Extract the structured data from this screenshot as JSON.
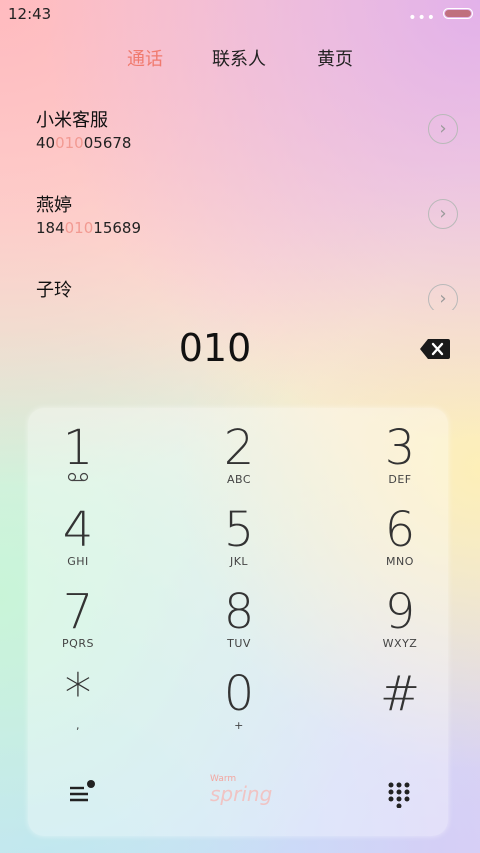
{
  "status": {
    "time": "12:43",
    "more": "•••"
  },
  "tabs": [
    "通话",
    "联系人",
    "黄页"
  ],
  "contacts": [
    {
      "name": "小米客服",
      "num_pre": "40",
      "num_hl": "010",
      "num_post": "05678"
    },
    {
      "name": "燕婷",
      "num_pre": "184",
      "num_hl": "010",
      "num_post": "15689"
    },
    {
      "name": "子玲",
      "num_pre": "",
      "num_hl": "",
      "num_post": ""
    }
  ],
  "dial": {
    "input": "010"
  },
  "keys": [
    {
      "digit": "1",
      "letters": ""
    },
    {
      "digit": "2",
      "letters": "ABC"
    },
    {
      "digit": "3",
      "letters": "DEF"
    },
    {
      "digit": "4",
      "letters": "GHI"
    },
    {
      "digit": "5",
      "letters": "JKL"
    },
    {
      "digit": "6",
      "letters": "MNO"
    },
    {
      "digit": "7",
      "letters": "PQRS"
    },
    {
      "digit": "8",
      "letters": "TUV"
    },
    {
      "digit": "9",
      "letters": "WXYZ"
    },
    {
      "digit": "*",
      "letters": ","
    },
    {
      "digit": "0",
      "letters": "+"
    },
    {
      "digit": "#",
      "letters": ""
    }
  ],
  "brand": {
    "line1": "Warm",
    "line2": "spring"
  },
  "icons": {
    "menu": "menu-with-dot-icon",
    "keypad": "keypad-grid-icon",
    "backspace": "backspace-icon",
    "voicemail": "voicemail-icon",
    "chevron": "chevron-right-icon"
  },
  "colors": {
    "accent": "#f07a6e",
    "highlight": "#f29a92"
  }
}
